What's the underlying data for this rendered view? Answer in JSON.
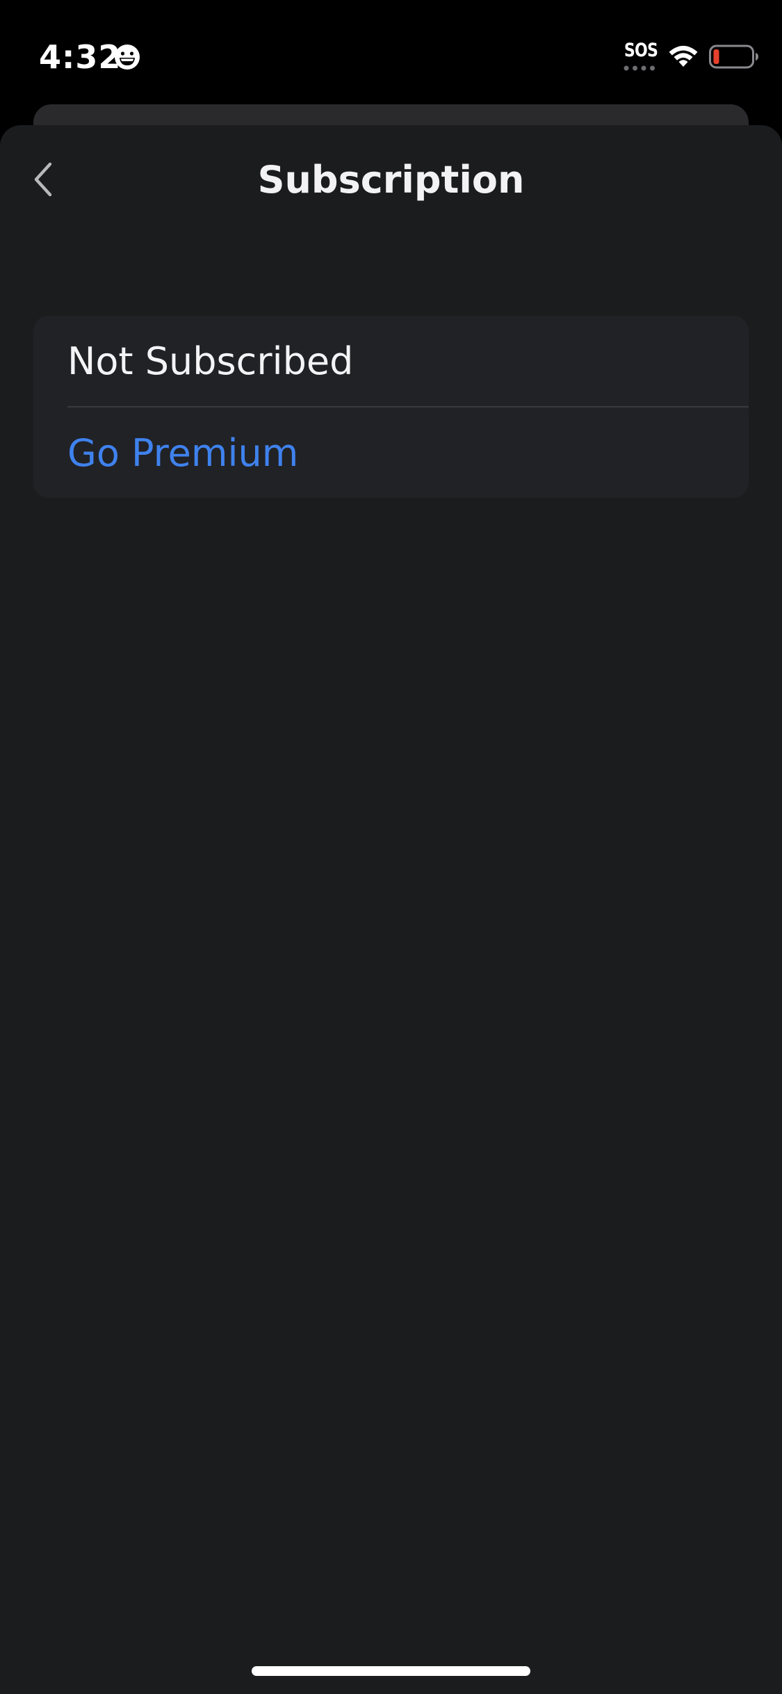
{
  "status_bar": {
    "time": "4:32",
    "sos_label": "SOS",
    "emoji_icon": "grinning-face-icon",
    "wifi_icon": "wifi-icon",
    "battery_icon": "battery-low-icon",
    "battery_color": "#e6412e"
  },
  "nav": {
    "title": "Subscription",
    "back_icon": "chevron-left-icon"
  },
  "subscription_card": {
    "status_label": "Not Subscribed",
    "action_label": "Go Premium"
  },
  "colors": {
    "accent": "#3f82ee",
    "background": "#1b1c1e",
    "card": "#212226"
  }
}
